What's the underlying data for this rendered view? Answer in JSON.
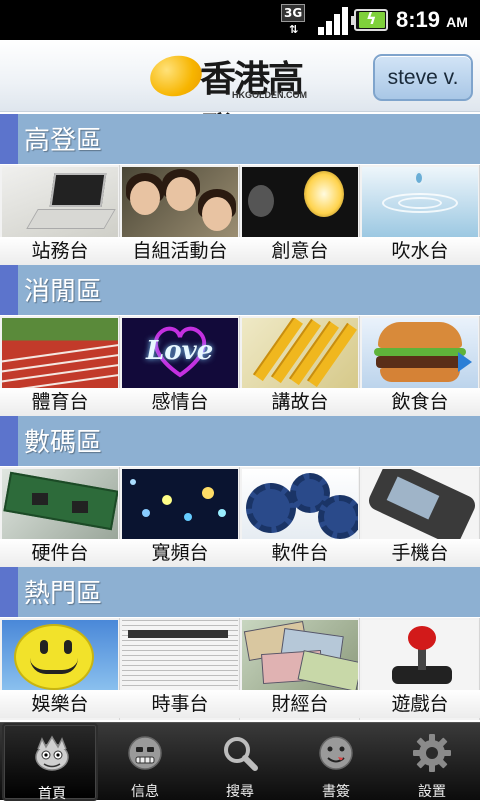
{
  "status_bar": {
    "network": "3G",
    "time": "8:19",
    "ampm": "AM"
  },
  "header": {
    "logo_text": "香港高登",
    "logo_subtext": "HKGOLDEN.COM",
    "user_button": "steve v."
  },
  "sections": [
    {
      "title": "高登區",
      "items": [
        "站務台",
        "自組活動台",
        "創意台",
        "吹水台"
      ]
    },
    {
      "title": "消閒區",
      "items": [
        "體育台",
        "感情台",
        "講故台",
        "飲食台"
      ]
    },
    {
      "title": "數碼區",
      "items": [
        "硬件台",
        "寬頻台",
        "軟件台",
        "手機台"
      ]
    },
    {
      "title": "熱門區",
      "items": [
        "娛樂台",
        "時事台",
        "財經台",
        "遊戲台"
      ]
    }
  ],
  "love_text": "Love",
  "bottom_nav": [
    {
      "label": "首頁",
      "icon": "home-face-icon",
      "active": true
    },
    {
      "label": "信息",
      "icon": "messages-face-icon",
      "active": false
    },
    {
      "label": "搜尋",
      "icon": "search-icon",
      "active": false
    },
    {
      "label": "書簽",
      "icon": "bookmark-face-icon",
      "active": false
    },
    {
      "label": "設置",
      "icon": "gear-icon",
      "active": false
    }
  ]
}
